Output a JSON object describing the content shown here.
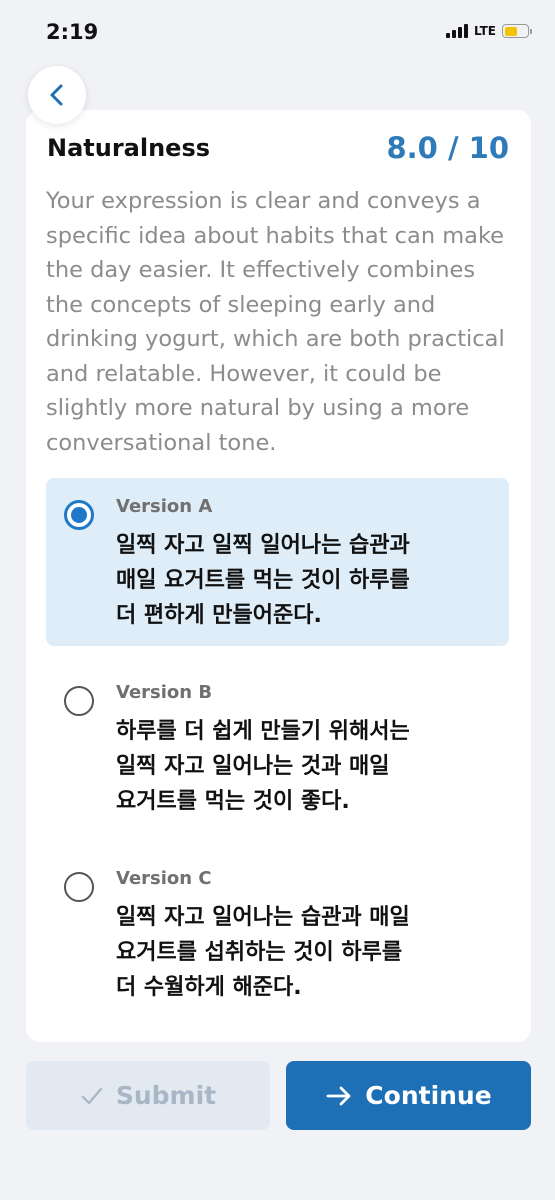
{
  "status_bar": {
    "time": "2:19",
    "network": "LTE",
    "icons": [
      "signal-icon",
      "battery-icon"
    ]
  },
  "header": {
    "back_icon": "chevron-left-icon"
  },
  "metric": {
    "title": "Naturalness",
    "score": "8.0 / 10",
    "feedback": "Your expression is clear and conveys a specific idea about habits that can make the day easier. It effectively combines the concepts of sleeping early and drinking yogurt, which are both practical and relatable. However, it could be slightly more natural by using a more conversational tone."
  },
  "options": [
    {
      "label": "Version A",
      "lines": [
        "일찍 자고 일찍 일어나는 습관과",
        "매일 요거트를 먹는 것이 하루를",
        "더 편하게 만들어준다."
      ],
      "selected": true
    },
    {
      "label": "Version B",
      "lines": [
        "하루를 더 쉽게 만들기 위해서는",
        "일찍 자고 일어나는 것과 매일",
        "요거트를 먹는 것이 좋다."
      ],
      "selected": false
    },
    {
      "label": "Version C",
      "lines": [
        "일찍 자고 일어나는 습관과 매일",
        "요거트를 섭취하는 것이 하루를",
        "더 수월하게 해준다."
      ],
      "selected": false
    }
  ],
  "actions": {
    "submit_label": "Submit",
    "submit_icon": "checkmark-icon",
    "continue_label": "Continue",
    "continue_icon": "arrow-right-icon"
  },
  "colors": {
    "accent": "#1d6fb6",
    "score": "#2f7ab8",
    "selected_bg": "#deedf7",
    "page_bg": "#f1f2f6"
  }
}
